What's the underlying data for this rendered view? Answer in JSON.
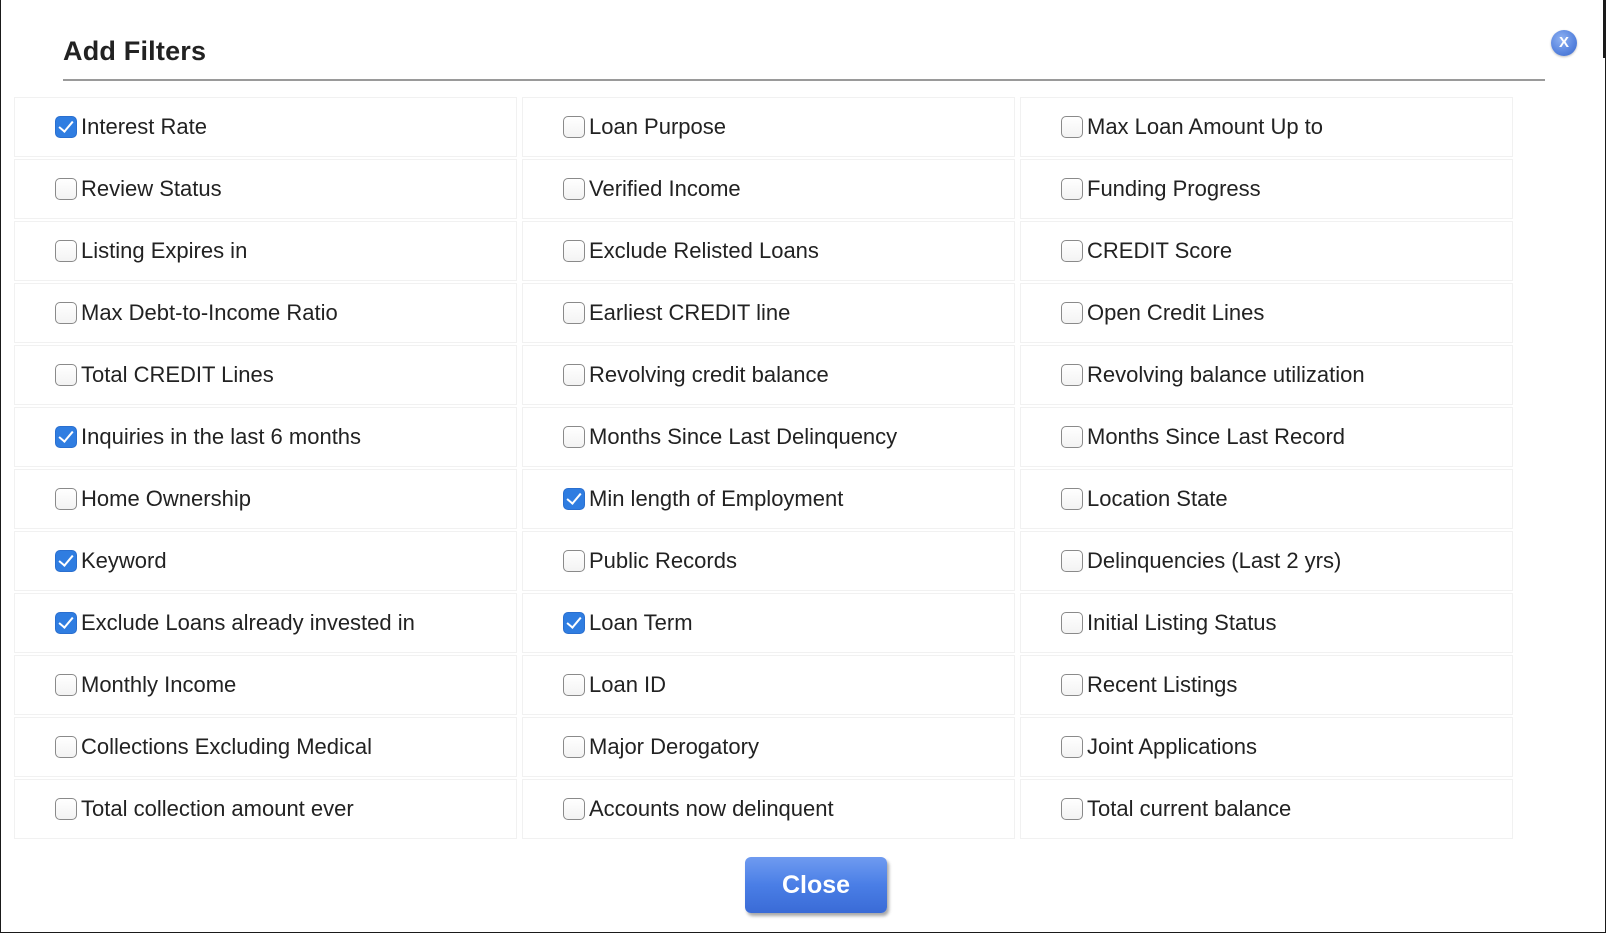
{
  "dialog": {
    "title": "Add Filters",
    "close_icon_label": "X",
    "close_button_label": "Close",
    "accent_color": "#4a7ee6"
  },
  "filters": [
    {
      "label": "Interest Rate",
      "checked": true
    },
    {
      "label": "Loan Purpose",
      "checked": false
    },
    {
      "label": "Max Loan Amount Up to",
      "checked": false
    },
    {
      "label": "Review Status",
      "checked": false
    },
    {
      "label": "Verified Income",
      "checked": false
    },
    {
      "label": "Funding Progress",
      "checked": false
    },
    {
      "label": "Listing Expires in",
      "checked": false
    },
    {
      "label": "Exclude Relisted Loans",
      "checked": false
    },
    {
      "label": "CREDIT Score",
      "checked": false
    },
    {
      "label": "Max Debt-to-Income Ratio",
      "checked": false
    },
    {
      "label": "Earliest CREDIT line",
      "checked": false
    },
    {
      "label": "Open Credit Lines",
      "checked": false
    },
    {
      "label": "Total CREDIT Lines",
      "checked": false
    },
    {
      "label": "Revolving credit balance",
      "checked": false
    },
    {
      "label": "Revolving balance utilization",
      "checked": false
    },
    {
      "label": "Inquiries in the last 6 months",
      "checked": true
    },
    {
      "label": "Months Since Last Delinquency",
      "checked": false
    },
    {
      "label": "Months Since Last Record",
      "checked": false
    },
    {
      "label": "Home Ownership",
      "checked": false
    },
    {
      "label": "Min length of Employment",
      "checked": true
    },
    {
      "label": "Location State",
      "checked": false
    },
    {
      "label": "Keyword",
      "checked": true
    },
    {
      "label": "Public Records",
      "checked": false
    },
    {
      "label": "Delinquencies (Last 2 yrs)",
      "checked": false
    },
    {
      "label": "Exclude Loans already invested in",
      "checked": true
    },
    {
      "label": "Loan Term",
      "checked": true
    },
    {
      "label": "Initial Listing Status",
      "checked": false
    },
    {
      "label": "Monthly Income",
      "checked": false
    },
    {
      "label": "Loan ID",
      "checked": false
    },
    {
      "label": "Recent Listings",
      "checked": false
    },
    {
      "label": "Collections Excluding Medical",
      "checked": false
    },
    {
      "label": "Major Derogatory",
      "checked": false
    },
    {
      "label": "Joint Applications",
      "checked": false
    },
    {
      "label": "Total collection amount ever",
      "checked": false
    },
    {
      "label": "Accounts now delinquent",
      "checked": false
    },
    {
      "label": "Total current balance",
      "checked": false
    }
  ]
}
